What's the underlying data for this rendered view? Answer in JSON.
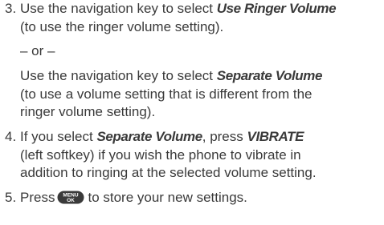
{
  "steps": [
    {
      "number": "3.",
      "line1_pre": "Use the navigation key to select ",
      "line1_em": "Use Ringer Volume",
      "line2": "(to use the ringer volume setting).",
      "or_text": "– or –",
      "alt_line1_pre": "Use the navigation key to select ",
      "alt_line1_em": "Separate Volume",
      "alt_line2": "(to use a volume setting that is different from the",
      "alt_line3": "ringer volume setting)."
    },
    {
      "number": "4.",
      "line1_pre": "If you select ",
      "line1_em": "Separate Volume",
      "line1_mid": ", press ",
      "line1_em2": "VIBRATE",
      "line2": "(left softkey) if you wish the phone to vibrate in",
      "line3": "addition to ringing at the selected volume setting."
    },
    {
      "number": "5.",
      "text_pre": "Press",
      "key_top": "MENU",
      "key_bottom": "OK",
      "text_post": "to store your new settings."
    }
  ],
  "colors": {
    "text": "#3a3a3a",
    "key_fill": "#3a3a3a",
    "key_text": "#ffffff"
  },
  "icons": {
    "menu_ok_key": "menu-ok-key-icon"
  }
}
